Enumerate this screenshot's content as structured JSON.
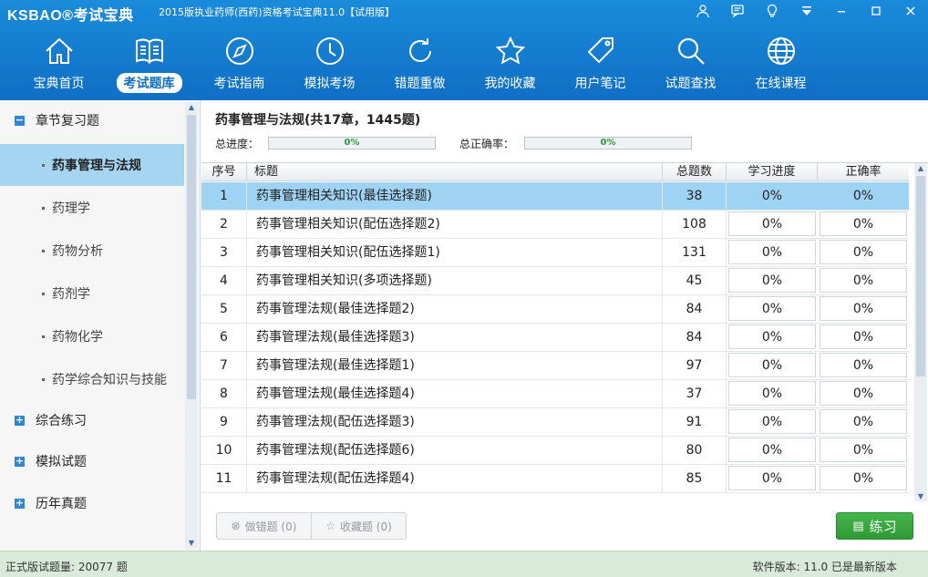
{
  "app": {
    "logo": "KSBAO®考试宝典",
    "title": "2015版执业药师(西药)资格考试宝典11.0【试用版】"
  },
  "nav": [
    {
      "label": "宝典首页",
      "icon": "home-icon"
    },
    {
      "label": "考试题库",
      "icon": "book-icon"
    },
    {
      "label": "考试指南",
      "icon": "compass-icon"
    },
    {
      "label": "模拟考场",
      "icon": "clock-icon"
    },
    {
      "label": "错题重做",
      "icon": "refresh-icon"
    },
    {
      "label": "我的收藏",
      "icon": "star-icon"
    },
    {
      "label": "用户笔记",
      "icon": "tag-icon"
    },
    {
      "label": "试题查找",
      "icon": "search-icon"
    },
    {
      "label": "在线课程",
      "icon": "globe-icon"
    }
  ],
  "sidebar": {
    "group_chapter": "章节复习题",
    "items": [
      "药事管理与法规",
      "药理学",
      "药物分析",
      "药剂学",
      "药物化学",
      "药学综合知识与技能"
    ],
    "group_practice": "综合练习",
    "group_mock": "模拟试题",
    "group_past": "历年真题"
  },
  "main": {
    "title": "药事管理与法规(共17章，1445题)",
    "total_progress_label": "总进度：",
    "total_progress_value": "0%",
    "total_accuracy_label": "总正确率：",
    "total_accuracy_value": "0%"
  },
  "table": {
    "headers": [
      "序号",
      "标题",
      "总题数",
      "学习进度",
      "正确率"
    ],
    "rows": [
      {
        "no": "1",
        "title": "药事管理相关知识(最佳选择题)",
        "total": "38",
        "progress": "0%",
        "accuracy": "0%"
      },
      {
        "no": "2",
        "title": "药事管理相关知识(配伍选择题2)",
        "total": "108",
        "progress": "0%",
        "accuracy": "0%"
      },
      {
        "no": "3",
        "title": "药事管理相关知识(配伍选择题1)",
        "total": "131",
        "progress": "0%",
        "accuracy": "0%"
      },
      {
        "no": "4",
        "title": "药事管理相关知识(多项选择题)",
        "total": "45",
        "progress": "0%",
        "accuracy": "0%"
      },
      {
        "no": "5",
        "title": "药事管理法规(最佳选择题2)",
        "total": "84",
        "progress": "0%",
        "accuracy": "0%"
      },
      {
        "no": "6",
        "title": "药事管理法规(最佳选择题3)",
        "total": "84",
        "progress": "0%",
        "accuracy": "0%"
      },
      {
        "no": "7",
        "title": "药事管理法规(最佳选择题1)",
        "total": "97",
        "progress": "0%",
        "accuracy": "0%"
      },
      {
        "no": "8",
        "title": "药事管理法规(最佳选择题4)",
        "total": "37",
        "progress": "0%",
        "accuracy": "0%"
      },
      {
        "no": "9",
        "title": "药事管理法规(配伍选择题3)",
        "total": "91",
        "progress": "0%",
        "accuracy": "0%"
      },
      {
        "no": "10",
        "title": "药事管理法规(配伍选择题6)",
        "total": "80",
        "progress": "0%",
        "accuracy": "0%"
      },
      {
        "no": "11",
        "title": "药事管理法规(配伍选择题4)",
        "total": "85",
        "progress": "0%",
        "accuracy": "0%"
      }
    ]
  },
  "buttons": {
    "wrong_redo": "做错题 (0)",
    "favorites": "收藏题 (0)",
    "practice": "练习"
  },
  "status": {
    "left": "正式版试题量: 20077 题",
    "right": "软件版本: 11.0 已是最新版本"
  },
  "colors": {
    "header": "#1a8bdb",
    "selected_row": "#9fd3f3",
    "practice_button": "#3aa940",
    "statusbar": "#d9eadb"
  }
}
